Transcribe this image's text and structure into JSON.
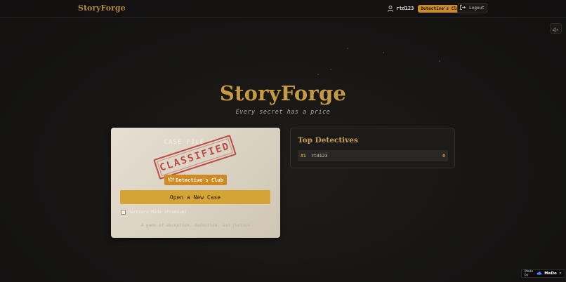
{
  "header": {
    "brand": "StoryForge",
    "username": "rtd123",
    "user_badge": "Detective's Club",
    "logout_label": "Logout"
  },
  "hero": {
    "title": "StoryForge",
    "subtitle": "Every secret has a price"
  },
  "case_card": {
    "case_file": "CASE FILE #7??",
    "stamp": "CLASSIFIED",
    "badge_label": "Detective's Club",
    "open_button": "Open a New Case",
    "hardcore_label": "Hardcore Mode (Premium)",
    "hardcore_checked": false,
    "tagline": "A game of deception, deduction, and justice"
  },
  "leaderboard": {
    "title": "Top Detectives",
    "entries": [
      {
        "rank": "#1",
        "name": "rtd123",
        "score": "0"
      }
    ]
  },
  "made_with": {
    "prefix": "Made by",
    "brand": "MeDo",
    "close": "×"
  },
  "colors": {
    "accent_gold": "#c49a44",
    "button_gold": "#d4a534",
    "badge_orange": "#cf8a26",
    "stamp_red": "#b73a32"
  },
  "icons": {
    "user": "user-icon",
    "logout": "logout-icon",
    "sound": "volume-muted-icon",
    "crown": "crown-icon",
    "made_logo": "cloud-logo-icon"
  }
}
